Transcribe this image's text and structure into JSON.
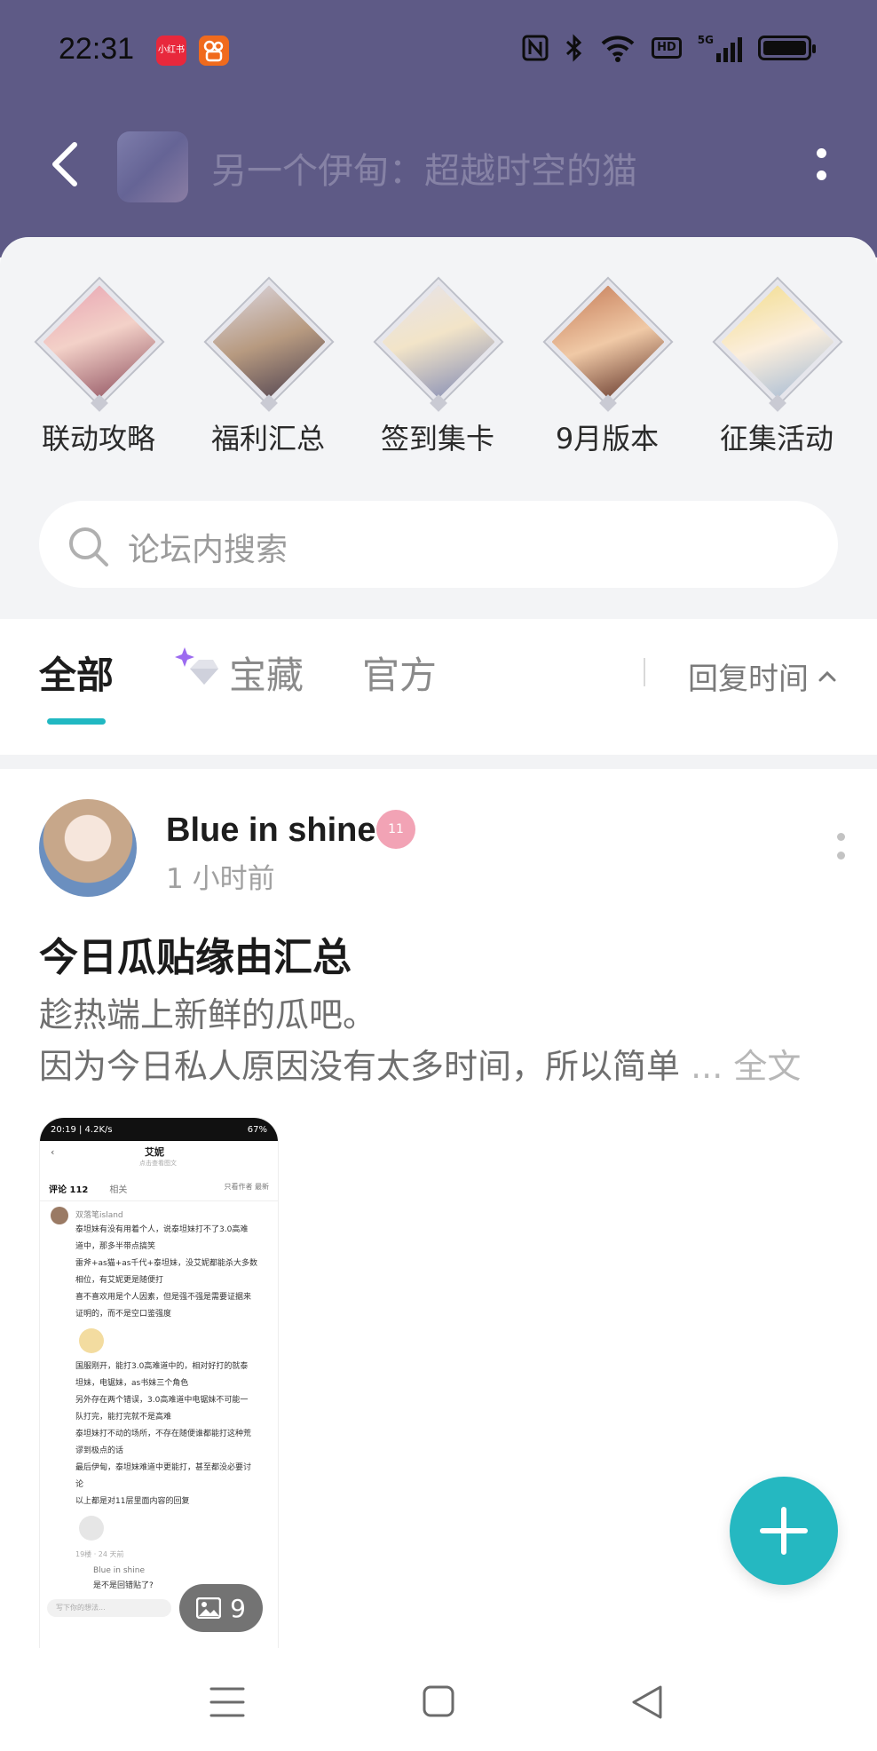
{
  "status_bar": {
    "time": "22:31",
    "apps": [
      {
        "label": "小红书",
        "color": "#e8283c"
      },
      {
        "label": "",
        "color": "#f06a1d"
      }
    ],
    "icons": [
      "nfc-icon",
      "bluetooth-icon",
      "wifi-icon",
      "hd-icon",
      "signal-5g-icon",
      "battery-icon"
    ],
    "network_label": "HD",
    "gen_label": "5G"
  },
  "header": {
    "title": "另一个伊甸：超越时空的猫",
    "background": "#5e5a86"
  },
  "quick_links": [
    {
      "label": "联动攻略",
      "colors": [
        "#e8a3b2",
        "#8a4a5a"
      ]
    },
    {
      "label": "福利汇总",
      "colors": [
        "#c9c2d2",
        "#4a3e4e"
      ]
    },
    {
      "label": "签到集卡",
      "colors": [
        "#d9d4e0",
        "#7c86b4"
      ]
    },
    {
      "label": "9月版本",
      "colors": [
        "#c47a56",
        "#5a2c22"
      ]
    },
    {
      "label": "征集活动",
      "colors": [
        "#f2dc8a",
        "#9fb7d4"
      ]
    }
  ],
  "search": {
    "placeholder": "论坛内搜索"
  },
  "tabs": {
    "items": [
      {
        "label": "全部",
        "active": true
      },
      {
        "label": "宝藏",
        "active": false
      },
      {
        "label": "官方",
        "active": false
      }
    ],
    "sort_label": "回复时间",
    "accent": "#21b8c2"
  },
  "post": {
    "author": "Blue in shine",
    "level": "11",
    "time": "1 小时前",
    "title": "今日瓜贴缘由汇总",
    "excerpt_line1": "趁热端上新鲜的瓜吧。",
    "excerpt_line2": "因为今日私人原因没有太多时间，所以简单",
    "ellipsis": " ... ",
    "more_label": "全文",
    "image_count": "9",
    "thumbnail": {
      "status_time": "20:19 | 4.2K/s",
      "status_battery": "67%",
      "header_title": "艾妮",
      "header_sub": "点击查看图文",
      "tabs": [
        "评论 112",
        "相关"
      ],
      "filter": "只看作者  最新",
      "commenter": "双落笔island",
      "lines": [
        "泰坦妹有没有用着个人，说泰坦妹打不了3.0高难",
        "道中，那多半带点搞笑",
        "雷斧+as猫+as千代+泰坦妹，没艾妮都能杀大多数",
        "相位，有艾妮更是随便打",
        "喜不喜欢用是个人因素，但是强不强是需要证据来",
        "证明的，而不是空口鉴强度",
        "国服刚开，能打3.0高难道中的，相对好打的就泰",
        "坦妹，电锯妹，as书妹三个角色",
        "另外存在两个错误，3.0高难道中电锯妹不可能一",
        "队打完，能打完就不是高难",
        "泰坦妹打不动的场所，不存在随便谁都能打这种荒",
        "谬到极点的话",
        "最后伊甸，泰坦妹难道中更能打，甚至都没必要讨",
        "论",
        "以上都是对11层里面内容的回复"
      ],
      "meta": "19楼 · 24 天前",
      "reply_user": "Blue in shine",
      "reply_text": "是不是回错贴了?",
      "input_placeholder": "写下你的想法..."
    }
  },
  "fab_label": "+"
}
